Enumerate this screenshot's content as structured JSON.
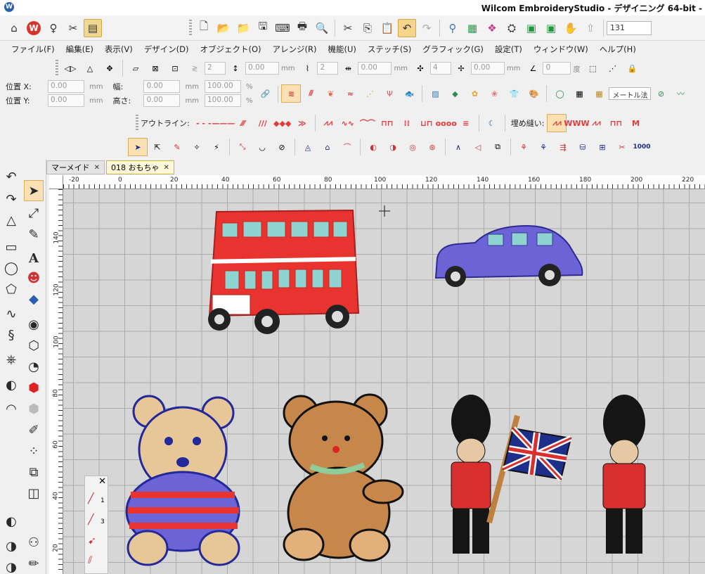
{
  "title": "Wilcom EmbroideryStudio - デザイニング 64-bit -",
  "toolbar": {
    "zoom_value": "131"
  },
  "menu": [
    "ファイル(F)",
    "編集(E)",
    "表示(V)",
    "デザイン(D)",
    "オブジェクト(O)",
    "アレンジ(R)",
    "機能(U)",
    "ステッチ(S)",
    "グラフィック(G)",
    "設定(T)",
    "ウィンドウ(W)",
    "ヘルプ(H)"
  ],
  "transform_bar": {
    "fields": [
      "2",
      "0.00",
      "2",
      "0.00",
      "4",
      "0.00",
      "0"
    ],
    "units": [
      "mm",
      "mm",
      "mm",
      "度"
    ]
  },
  "position": {
    "x_label": "位置 X:",
    "y_label": "位置 Y:",
    "x_value": "0.00",
    "y_value": "0.00",
    "width_label": "幅:",
    "height_label": "高さ:",
    "width_value": "0.00",
    "height_value": "0.00",
    "w_pct": "100.00",
    "h_pct": "100.00",
    "unit": "mm",
    "pct": "%"
  },
  "stitch_bar": {
    "method_select": "メートル法",
    "outline_label": "アウトライン:",
    "fill_label": "埋め縫い:",
    "count_label": "1000"
  },
  "tabs": [
    {
      "label": "マーメイド",
      "close": "✕"
    },
    {
      "label": "018 おもちゃ",
      "close": "✕"
    }
  ],
  "ruler_top": [
    "-20",
    "0",
    "20",
    "40",
    "60",
    "80",
    "100",
    "120",
    "140",
    "160",
    "180",
    "200",
    "220"
  ],
  "ruler_left": [
    "140",
    "120",
    "100",
    "80",
    "60",
    "40",
    "20"
  ],
  "float_panel": {
    "close": "✕",
    "items": [
      "1",
      "3"
    ]
  },
  "colors": {
    "accent": "#f2b94a",
    "bus_red": "#e8332e",
    "car_blue": "#6b63d6",
    "teddy_brown": "#c8874a",
    "guard_red": "#d92f2f",
    "flag_blue": "#1e2f8a"
  }
}
